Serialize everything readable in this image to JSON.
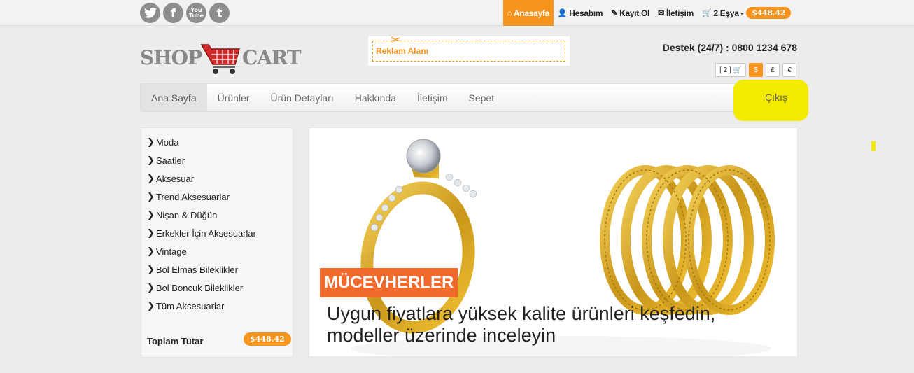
{
  "social": [
    {
      "icon": "twitter-icon",
      "glyph": "🐦"
    },
    {
      "icon": "facebook-icon",
      "glyph": "f"
    },
    {
      "icon": "youtube-icon",
      "glyph": "You Tube"
    },
    {
      "icon": "tumblr-icon",
      "glyph": "t"
    }
  ],
  "topnav": {
    "home": "Anasayfa",
    "account": "Hesabım",
    "register": "Kayıt Ol",
    "contact": "İletişim",
    "cart": "2 Eşya -",
    "cart_total": "$448.42"
  },
  "logo": {
    "left": "SHOP",
    "right": "CART"
  },
  "ad": {
    "label": "Reklam Alanı"
  },
  "support": "Destek (24/7) : 0800 1234 678",
  "currency": {
    "cart_count": "[ 2 ]",
    "options": [
      "$",
      "£",
      "€"
    ],
    "selected": "$"
  },
  "mainnav": {
    "items": [
      "Ana Sayfa",
      "Ürünler",
      "Ürün Detayları",
      "Hakkında",
      "İletişim",
      "Sepet"
    ],
    "logout": "Çıkış"
  },
  "sidebar": {
    "categories": [
      "Moda",
      "Saatler",
      "Aksesuar",
      "Trend Aksesuarlar",
      "Nişan & Düğün",
      "Erkekler İçin Aksesuarlar",
      "Vintage",
      "Bol Elmas Bileklikler",
      "Bol Boncuk Bileklikler",
      "Tüm Aksesuarlar"
    ],
    "total_label": "Toplam Tutar",
    "total_value": "$448.42"
  },
  "banner": {
    "tag": "MÜCEVHERLER",
    "text": "Uygun fiyatlara yüksek kalite ürünleri keşfedin, modeller üzerinde inceleyin"
  },
  "colors": {
    "accent": "#f7941d",
    "tag": "#ef6a2c",
    "highlight": "#f2ea00"
  }
}
